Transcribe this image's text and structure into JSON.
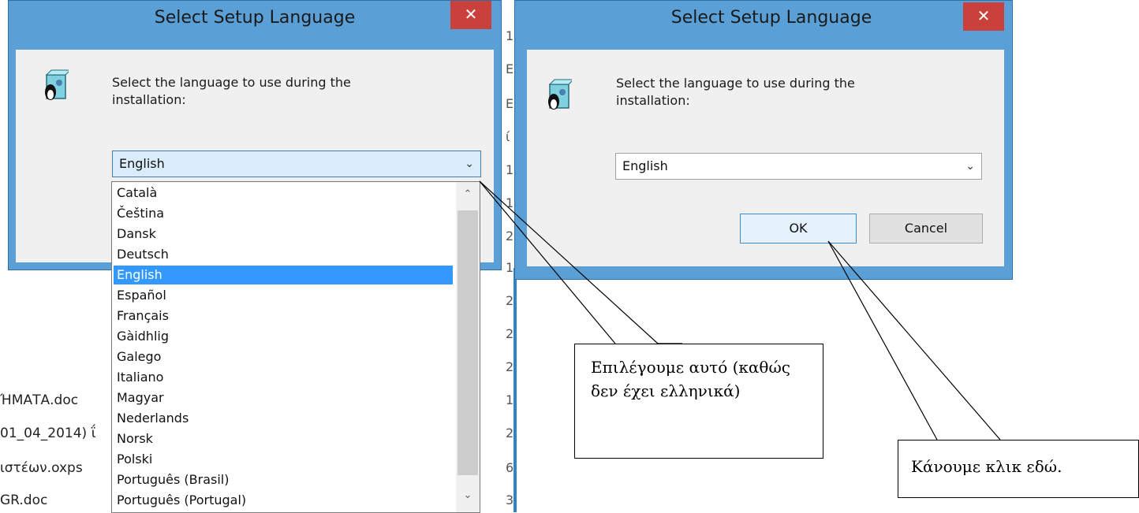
{
  "background": {
    "files": [
      "ΉΜΑΤΑ.doc",
      "01_04_2014) ΐ",
      "ιστέων.oxps",
      "GR.doc"
    ],
    "column_digits": [
      "1",
      "Ε",
      "Ε",
      "ί",
      "1",
      "1",
      "2",
      "1",
      "2",
      "2",
      "2",
      "1",
      "2",
      "6",
      "3"
    ]
  },
  "dialog1": {
    "title": "Select Setup Language",
    "close_glyph": "✕",
    "prompt": "Select the language to use during the installation:",
    "combo_value": "English",
    "combo_arrow": "⌄",
    "dropdown": {
      "items": [
        "Català",
        "Čeština",
        "Dansk",
        "Deutsch",
        "English",
        "Español",
        "Français",
        "Gàidhlig",
        "Galego",
        "Italiano",
        "Magyar",
        "Nederlands",
        "Norsk",
        "Polski",
        "Português (Brasil)",
        "Português (Portugal)"
      ],
      "selected": "English",
      "scroll_up_glyph": "⌃",
      "scroll_down_glyph": "⌄"
    }
  },
  "dialog2": {
    "title": "Select Setup Language",
    "close_glyph": "✕",
    "prompt": "Select the language to use during the installation:",
    "combo_value": "English",
    "combo_arrow": "⌄",
    "ok_label": "OK",
    "cancel_label": "Cancel"
  },
  "callouts": {
    "choose_this": "Επιλέγουμε αυτό (καθώς δεν έχει ελληνικά)",
    "click_here": "Κάνουμε κλικ εδώ."
  },
  "colors": {
    "title_bar": "#5aa0d6",
    "close_button": "#c9413a",
    "selection": "#3399ff",
    "dialog_client": "#f0f0f0"
  },
  "icons": [
    "setup-penguin-icon",
    "close-icon",
    "chevron-down-icon",
    "scroll-up-icon",
    "scroll-down-icon"
  ]
}
